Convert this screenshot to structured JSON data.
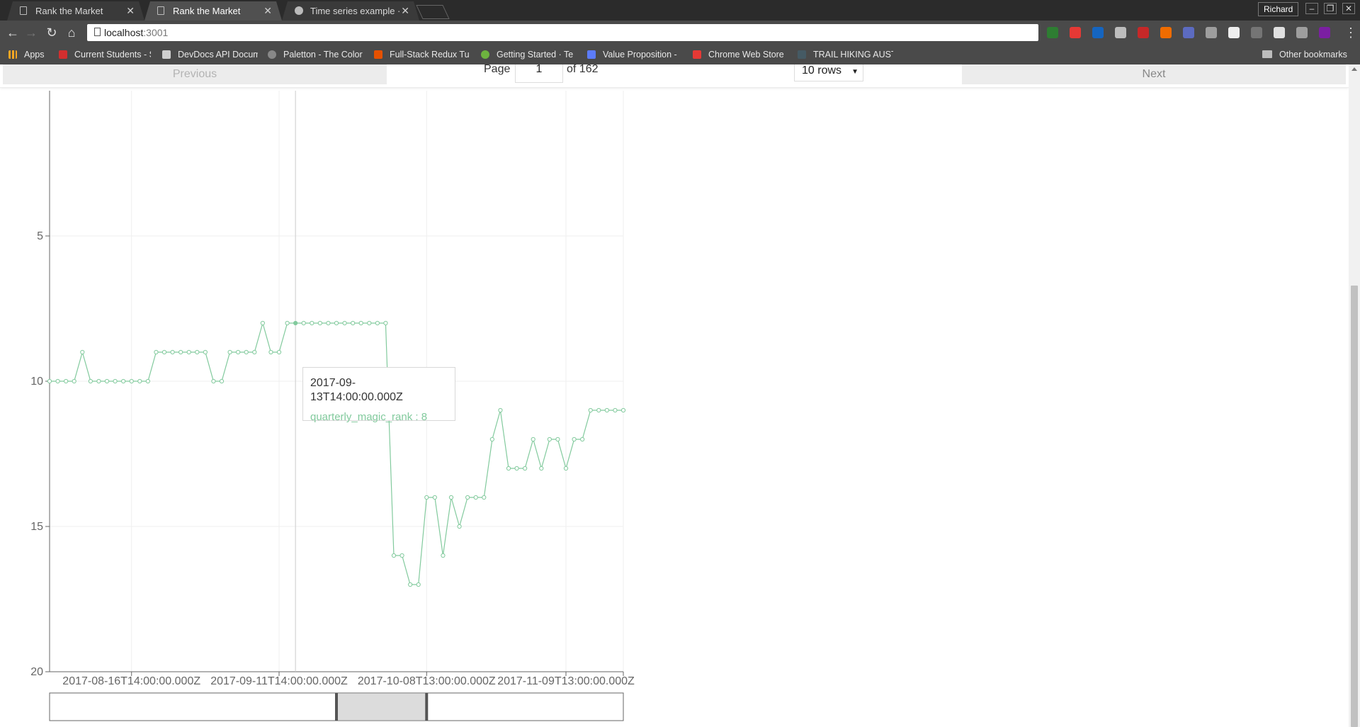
{
  "browser": {
    "tabs": [
      {
        "title": "Rank the Market",
        "active": false,
        "icon": "page-icon"
      },
      {
        "title": "Rank the Market",
        "active": true,
        "icon": "page-icon"
      },
      {
        "title": "Time series example · Is",
        "active": false,
        "icon": "github-icon"
      }
    ],
    "profile": "Richard",
    "url_host": "localhost",
    "url_port": ":3001",
    "bookmarks": [
      {
        "label": "Apps",
        "icon": "apps-grid-icon"
      },
      {
        "label": "Current Students - S",
        "icon": "bookmark-icon",
        "color": "#d32f2f"
      },
      {
        "label": "DevDocs API Docum",
        "icon": "bookmark-icon",
        "color": "#cfcfcf"
      },
      {
        "label": "Paletton - The Color",
        "icon": "bookmark-icon",
        "color": "#888888"
      },
      {
        "label": "Full-Stack Redux Tu",
        "icon": "star-icon",
        "color": "#e65100"
      },
      {
        "label": "Getting Started · Te",
        "icon": "leaf-icon",
        "color": "#6db33f"
      },
      {
        "label": "Value Proposition -",
        "icon": "bookmark-icon",
        "color": "#5c7cfa"
      },
      {
        "label": "Chrome Web Store",
        "icon": "store-icon",
        "color": "#e53935"
      },
      {
        "label": "TRAIL HIKING AUST",
        "icon": "bookmark-icon",
        "color": "#455a64"
      }
    ],
    "other_bookmarks": "Other bookmarks",
    "extension_colors": [
      "#2e7d32",
      "#e53935",
      "#1565c0",
      "#bdbdbd",
      "#c62828",
      "#ef6c00",
      "#5c6bc0",
      "#9e9e9e",
      "#eeeeee",
      "#757575",
      "#e0e0e0",
      "#9e9e9e",
      "#7b1fa2"
    ]
  },
  "pagination": {
    "previous_label": "Previous",
    "page_label": "Page",
    "page_value": "1",
    "of_label": "of 162",
    "rows_label": "10 rows",
    "next_label": "Next"
  },
  "tooltip": {
    "title": "2017-09-13T14:00:00.000Z",
    "series": "quarterly_magic_rank",
    "separator": " : ",
    "value": "8"
  },
  "chart_data": {
    "type": "line",
    "series": [
      {
        "name": "quarterly_magic_rank",
        "color": "#82ca9d",
        "values": [
          10,
          10,
          10,
          10,
          9,
          10,
          10,
          10,
          10,
          10,
          10,
          10,
          10,
          9,
          9,
          9,
          9,
          9,
          9,
          9,
          10,
          10,
          9,
          9,
          9,
          9,
          8,
          9,
          9,
          8,
          8,
          8,
          8,
          8,
          8,
          8,
          8,
          8,
          8,
          8,
          8,
          8,
          16,
          16,
          17,
          17,
          14,
          14,
          16,
          14,
          15,
          14,
          14,
          14,
          12,
          11,
          13,
          13,
          13,
          12,
          13,
          12,
          12,
          13,
          12,
          12,
          11,
          11,
          11,
          11,
          11
        ]
      }
    ],
    "x_tick_labels": [
      "2017-08-16T14:00:00.000Z",
      "2017-09-11T14:00:00.000Z",
      "2017-10-08T13:00:00.000Z",
      "2017-11-09T13:00:00.000Z"
    ],
    "x_tick_indices": [
      10,
      28,
      46,
      63
    ],
    "y_ticks": [
      5,
      10,
      15,
      20
    ],
    "ylim": [
      0,
      20
    ],
    "y_reversed": true,
    "grid": true,
    "active_index": 30,
    "brush": {
      "start_index": 35,
      "end_index": 46
    }
  }
}
